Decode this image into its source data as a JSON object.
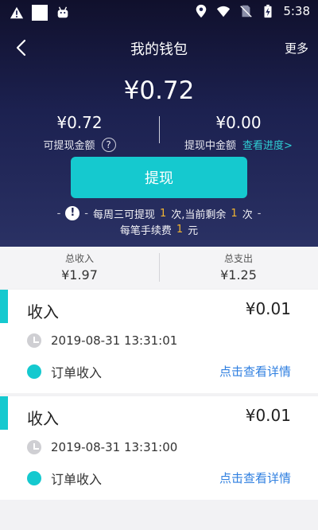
{
  "status_bar": {
    "time": "5:38",
    "icons": [
      "alert-icon",
      "square-icon",
      "android-icon",
      "location-icon",
      "wifi-icon",
      "no-sim-icon",
      "battery-charging-icon"
    ]
  },
  "nav": {
    "back_icon": "chevron-left-icon",
    "title": "我的钱包",
    "more_label": "更多"
  },
  "wallet": {
    "balance": "¥0.72",
    "available_amount": "¥0.72",
    "available_label": "可提现金额",
    "help_icon": "question-circle-icon",
    "pending_amount": "¥0.00",
    "pending_label": "提现中金额",
    "progress_link": "查看进度>",
    "withdraw_label": "提现",
    "notice_line1": {
      "prefix": "每周三可提现",
      "count1": "1",
      "middle": "次,当前剩余",
      "count2": "1",
      "suffix": "次"
    },
    "notice_line2": {
      "prefix": "每笔手续费",
      "fee": "1",
      "suffix": "元"
    }
  },
  "summary": {
    "income_label": "总收入",
    "income_value": "¥1.97",
    "expense_label": "总支出",
    "expense_value": "¥1.25"
  },
  "records": [
    {
      "type": "收入",
      "amount": "¥0.01",
      "time": "2019-08-31 13:31:01",
      "source": "订单收入",
      "detail_link": "点击查看详情"
    },
    {
      "type": "收入",
      "amount": "¥0.01",
      "time": "2019-08-31 13:31:00",
      "source": "订单收入",
      "detail_link": "点击查看详情"
    }
  ],
  "colors": {
    "accent": "#15c9cf",
    "highlight": "#f2b531",
    "link": "#2f7fe0",
    "header_bg": "#1c2150"
  }
}
